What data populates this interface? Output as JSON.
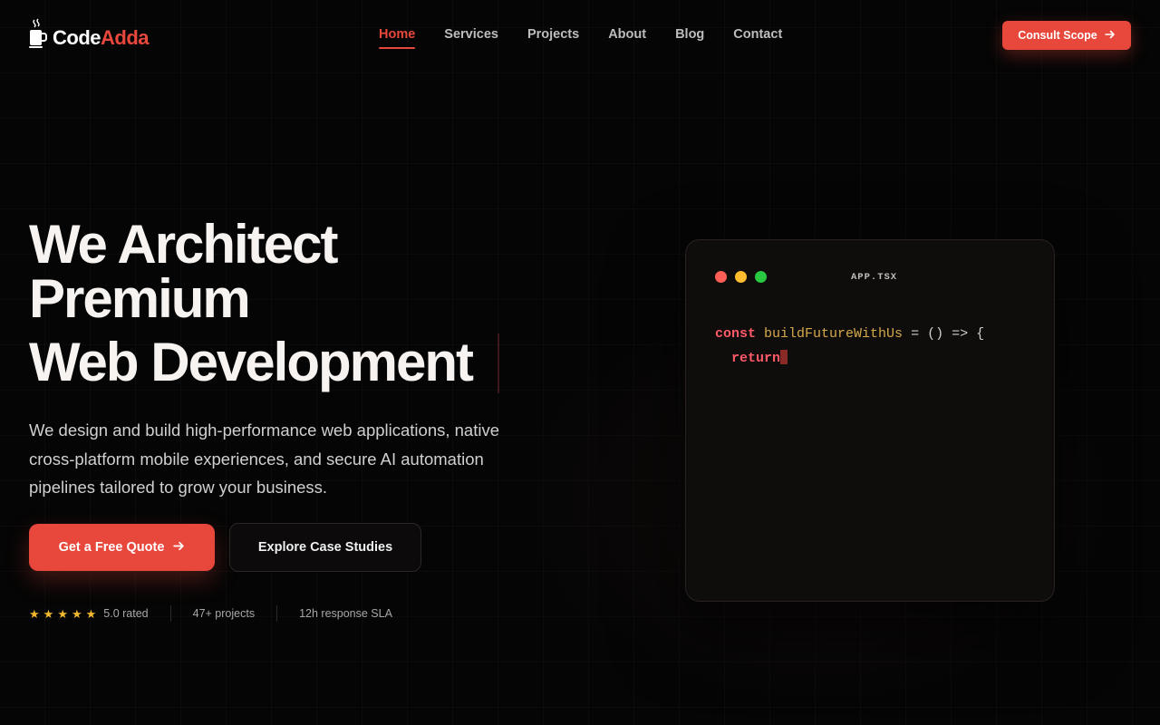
{
  "nav": {
    "logo_primary": "Code",
    "logo_accent": "Adda",
    "links": [
      {
        "label": "Home",
        "active": true
      },
      {
        "label": "Services",
        "active": false
      },
      {
        "label": "Projects",
        "active": false
      },
      {
        "label": "About",
        "active": false
      },
      {
        "label": "Blog",
        "active": false
      },
      {
        "label": "Contact",
        "active": false
      }
    ],
    "cta_label": "Consult Scope"
  },
  "hero": {
    "title_line1": "We Architect",
    "title_line2": "Premium",
    "title_line3": "Web Development",
    "description": "We design and build high-performance web applications, native cross-platform mobile experiences, and secure AI automation pipelines tailored to grow your business.",
    "primary_button": "Get a Free Quote",
    "secondary_button": "Explore Case Studies"
  },
  "stats": {
    "rating_stars": 5,
    "rating_label": "5.0 rated",
    "projects_label": "47+ projects",
    "sla_label": "12h response SLA"
  },
  "code_window": {
    "file_name": "APP.TSX",
    "line1_keyword": "const",
    "line1_name": "buildFutureWithUs",
    "line1_rest": " = () => {",
    "line2_keyword": "return"
  },
  "colors": {
    "accent": "#e8473b",
    "background": "#050505",
    "star": "#f5b82e",
    "dot_red": "#ff5f57",
    "dot_yellow": "#febc2e",
    "dot_green": "#28c840"
  }
}
